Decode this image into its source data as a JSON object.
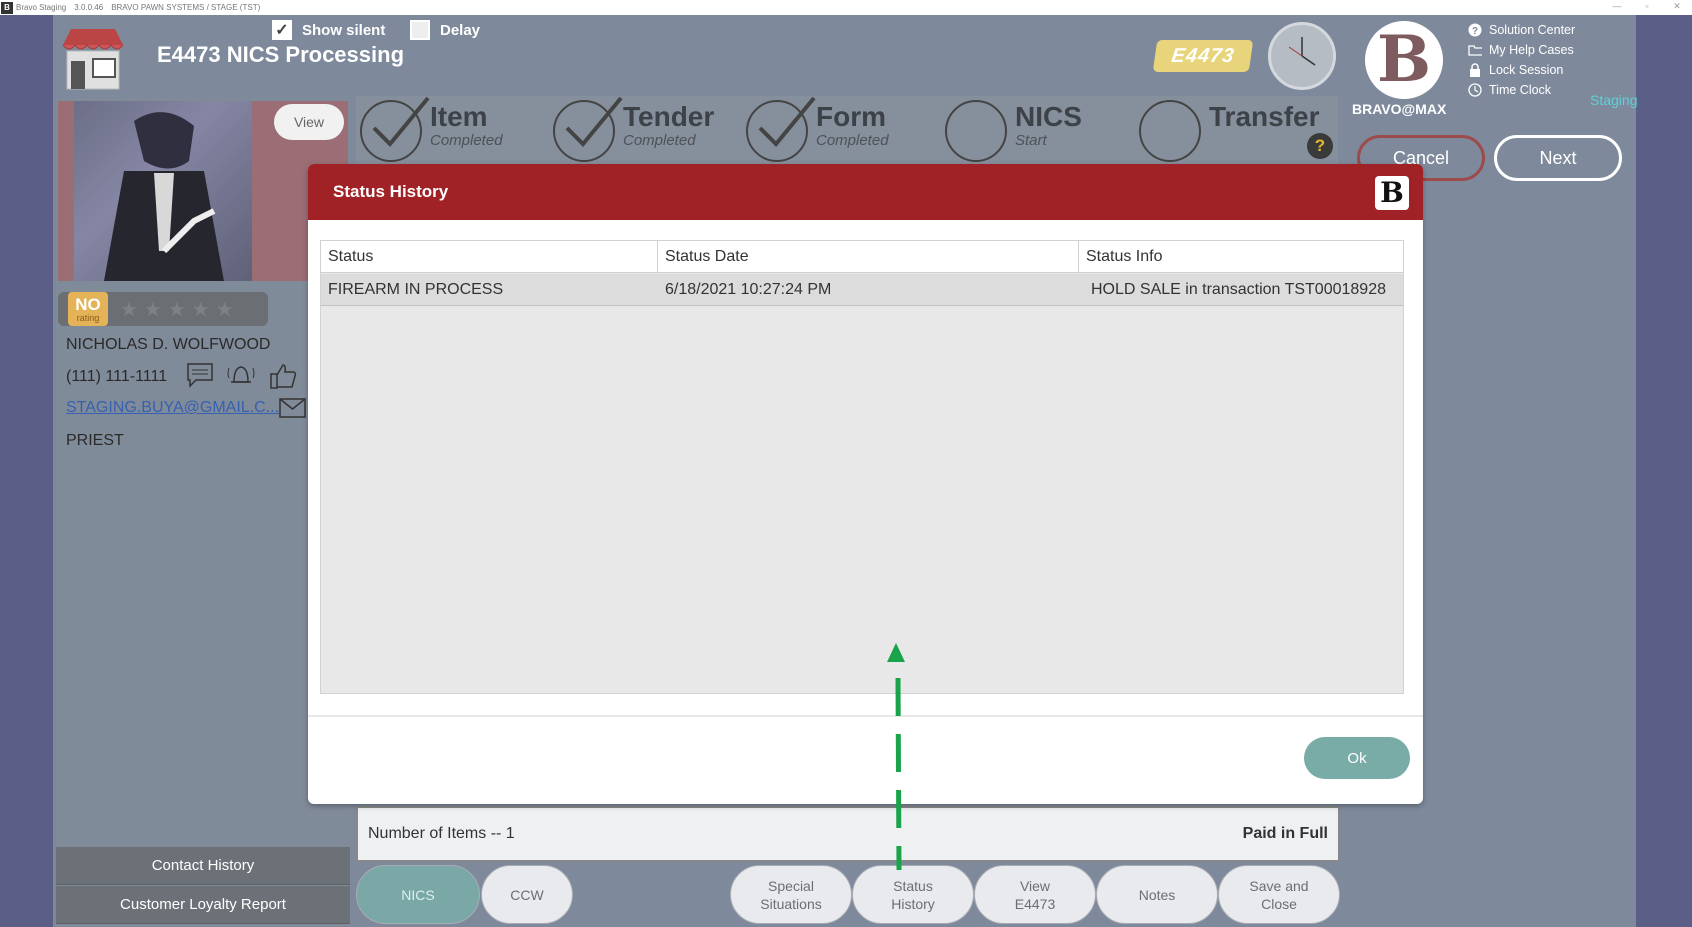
{
  "titlebar": {
    "app": "Bravo Staging",
    "version": "3.0.0.46",
    "company": "BRAVO PAWN SYSTEMS / STAGE (TST)",
    "min": "—",
    "max": "▫",
    "close": "✕"
  },
  "header": {
    "title": "E4473 NICS Processing",
    "show_silent": "Show silent",
    "delay": "Delay",
    "badge": "E4473",
    "user": "BRAVO@MAX",
    "logo_letter": "B",
    "environment": "Staging",
    "links": [
      "Solution Center",
      "My Help Cases",
      "Lock Session",
      "Time Clock"
    ]
  },
  "customer": {
    "view_label": "View",
    "rating_no": "NO",
    "rating_sub": "rating",
    "stars": "★★★★★",
    "name": "NICHOLAS D. WOLFWOOD",
    "phone": "(111) 111-1111",
    "email": "STAGING.BUYA@GMAIL.C...",
    "occupation": "PRIEST",
    "contact_history": "Contact History",
    "loyalty_report": "Customer Loyalty Report"
  },
  "steps": [
    {
      "name": "Item",
      "status": "Completed",
      "done": true
    },
    {
      "name": "Tender",
      "status": "Completed",
      "done": true
    },
    {
      "name": "Form",
      "status": "Completed",
      "done": true
    },
    {
      "name": "NICS",
      "status": "Start",
      "done": false
    },
    {
      "name": "Transfer",
      "status": "",
      "done": false
    }
  ],
  "help_glyph": "?",
  "nav": {
    "cancel": "Cancel",
    "next": "Next"
  },
  "summary": {
    "items": "Number of Items -- 1",
    "paid": "Paid in Full"
  },
  "tabs": [
    "NICS",
    "CCW",
    "Special\nSituations",
    "Status\nHistory",
    "View\nE4473",
    "Notes",
    "Save and\nClose"
  ],
  "modal": {
    "title": "Status History",
    "logo_letter": "B",
    "columns": [
      "Status",
      "Status Date",
      "Status Info"
    ],
    "rows": [
      [
        "FIREARM IN PROCESS",
        "6/18/2021 10:27:24 PM",
        "HOLD SALE in transaction TST00018928"
      ]
    ],
    "ok": "Ok"
  },
  "colors": {
    "modal_header": "#a02226",
    "ok_button": "#79aca7",
    "annotation_arrow": "#1aa34a",
    "accent_cyan": "#5fd0d8"
  },
  "icons": [
    "store-icon",
    "checkbox-checked-icon",
    "checkbox-empty-icon",
    "clock-icon",
    "question-circle-icon",
    "folder-icon",
    "lock-icon",
    "clock-small-icon",
    "chat-icon",
    "bell-icon",
    "thumbs-up-icon",
    "envelope-icon",
    "check-circle-icon",
    "empty-circle-icon",
    "help-icon",
    "arrow-up-icon"
  ]
}
